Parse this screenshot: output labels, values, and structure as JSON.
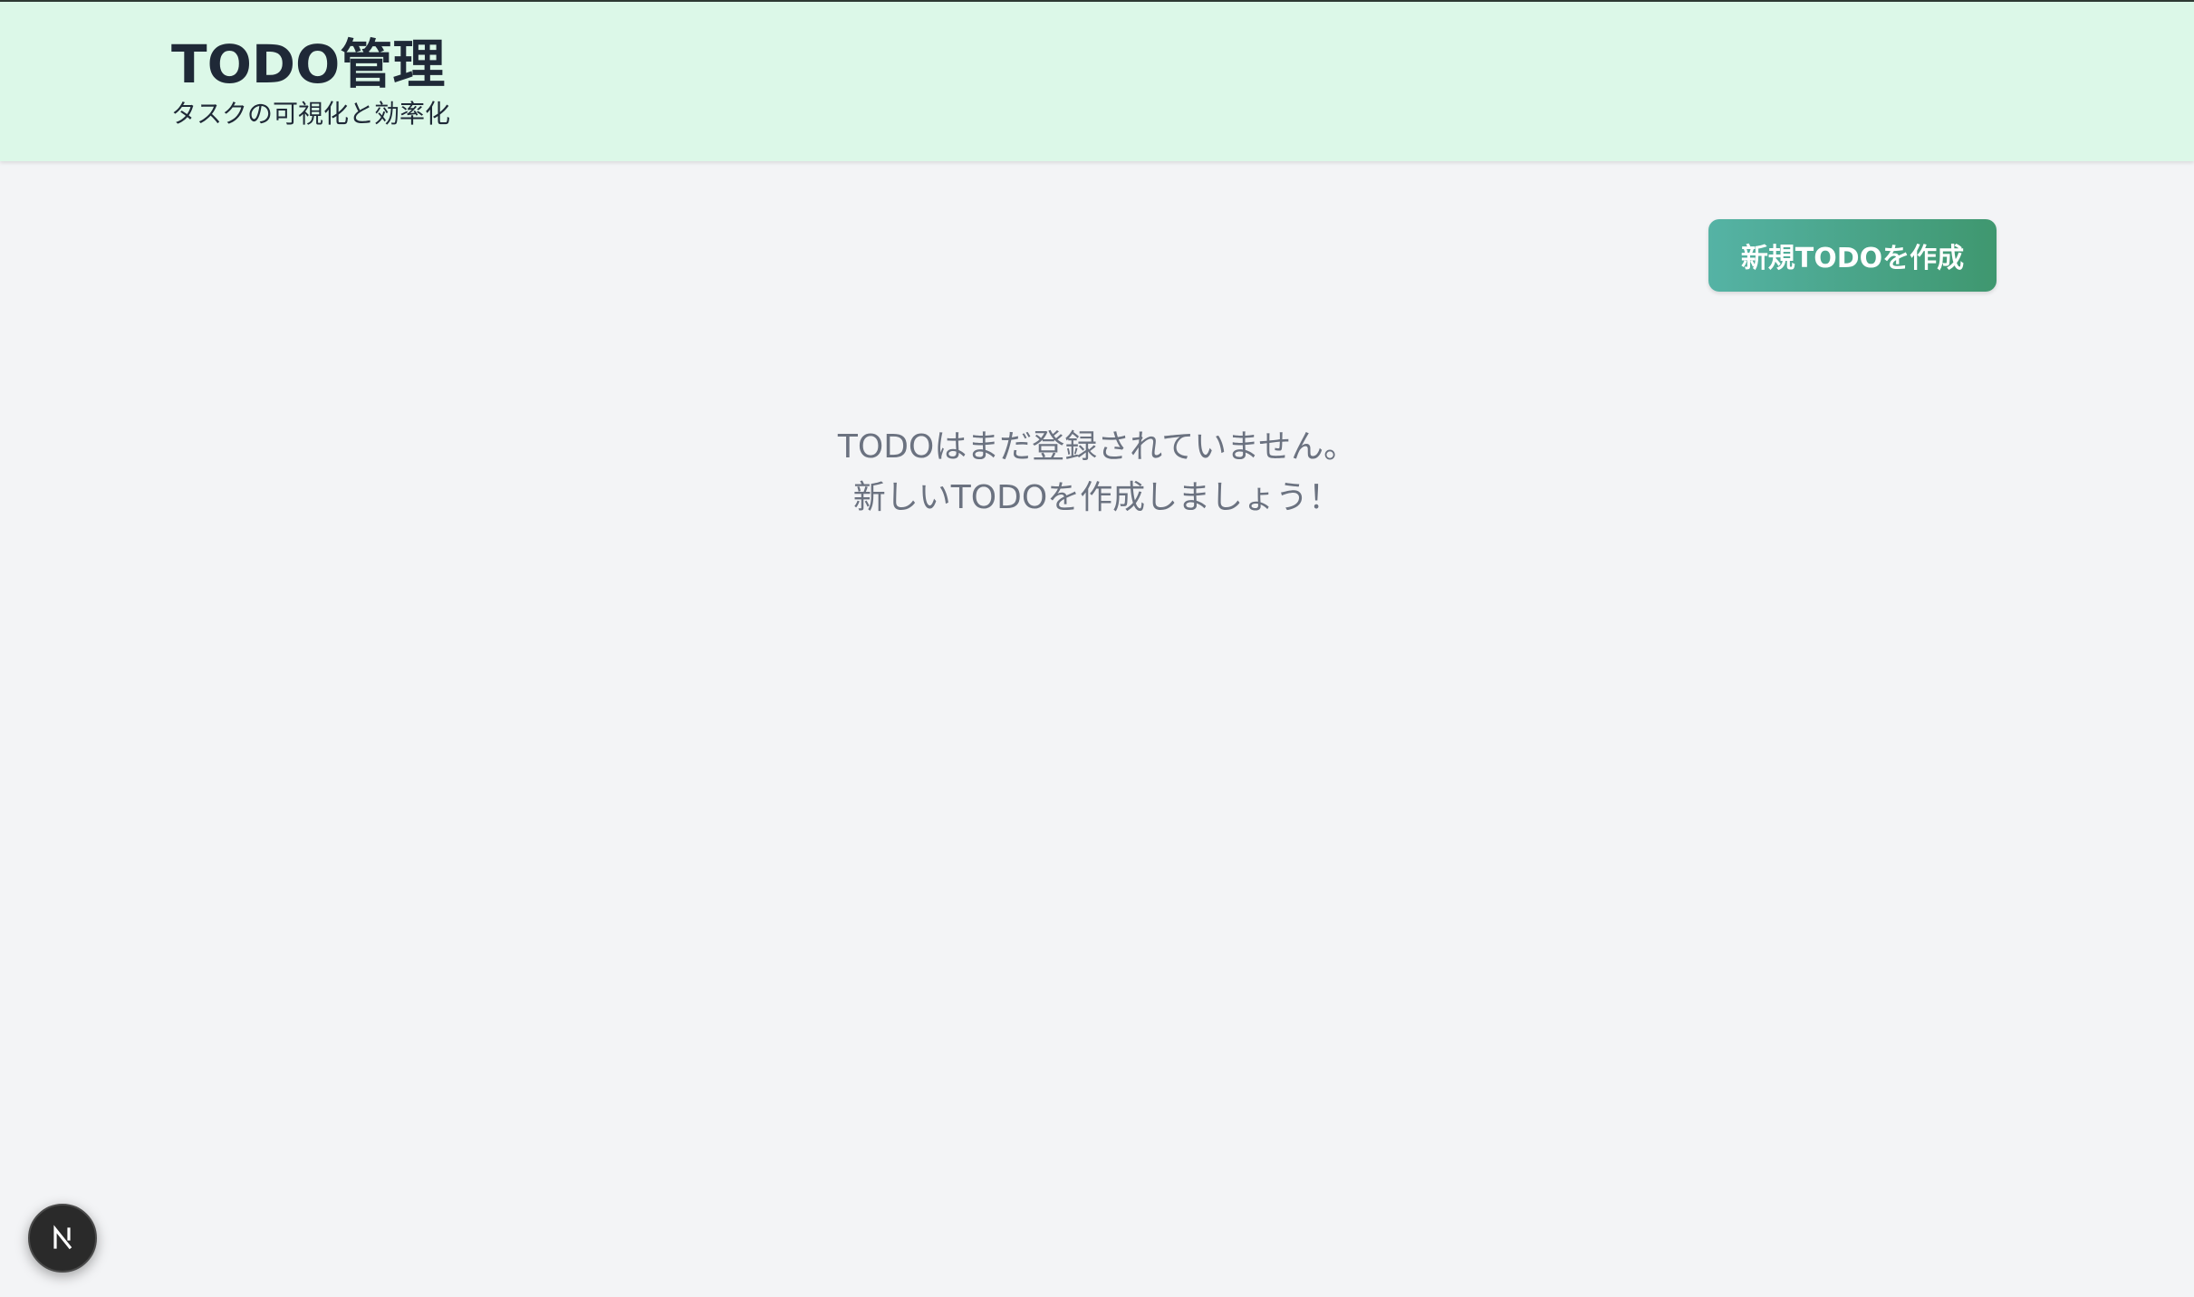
{
  "header": {
    "title": "TODO管理",
    "subtitle": "タスクの可視化と効率化"
  },
  "toolbar": {
    "create_label": "新規TODOを作成"
  },
  "empty_state": {
    "line1": "TODOはまだ登録されていません。",
    "line2": "新しいTODOを作成しましょう！"
  },
  "dev_indicator": {
    "icon": "nextjs-logo-icon"
  },
  "colors": {
    "header_bg": "#dcf8e8",
    "page_bg": "#f3f4f6",
    "button_gradient_start": "#55b3a5",
    "button_gradient_end": "#3f976f",
    "title_text": "#1f2937",
    "muted_text": "#6b7280"
  }
}
